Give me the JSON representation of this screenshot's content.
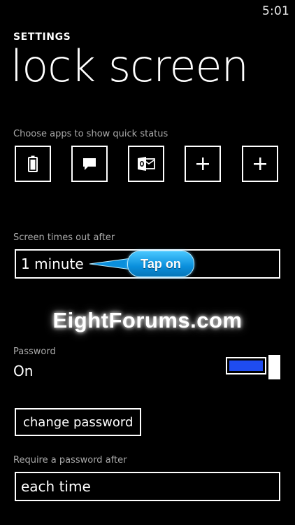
{
  "status_bar": {
    "time": "5:01"
  },
  "header": {
    "section": "SETTINGS",
    "title": "lock screen"
  },
  "quick_status": {
    "label": "Choose apps to show quick status",
    "tiles": [
      {
        "icon": "battery-icon"
      },
      {
        "icon": "message-icon"
      },
      {
        "icon": "outlook-icon"
      },
      {
        "icon": "plus-icon"
      },
      {
        "icon": "plus-icon"
      }
    ]
  },
  "screen_timeout": {
    "label": "Screen times out after",
    "value": "1 minute"
  },
  "annotation": {
    "callout_text": "Tap on",
    "watermark": "EightForums.com"
  },
  "password": {
    "label": "Password",
    "state": "On",
    "enabled": true,
    "accent_color": "#1f4cf0"
  },
  "change_password_button": {
    "label": "change password"
  },
  "require_password": {
    "label": "Require a password after",
    "value": "each time"
  }
}
